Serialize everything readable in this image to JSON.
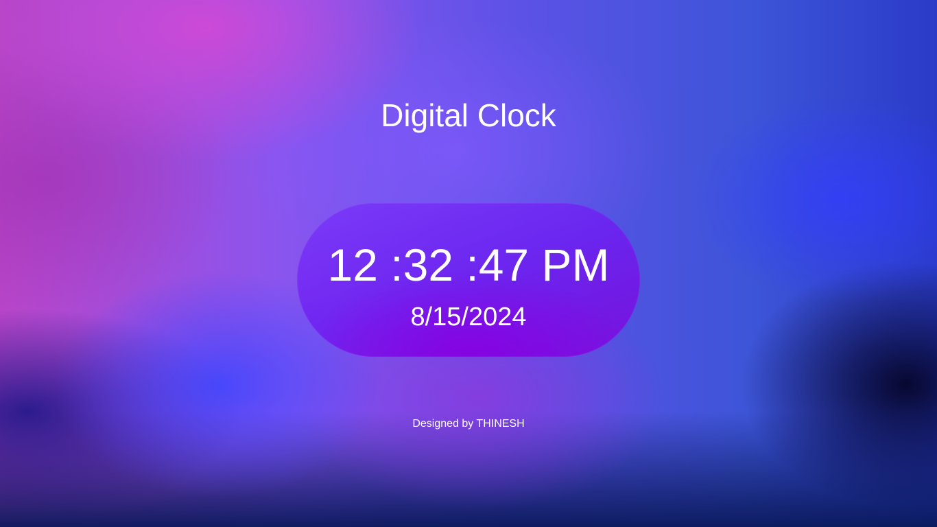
{
  "page": {
    "title": "Digital Clock"
  },
  "clock": {
    "time": "12 :32 :47 PM",
    "date": "8/15/2024"
  },
  "footer": {
    "credit": "Designed by THINESH"
  },
  "colors": {
    "text": "#ffffff",
    "pill": "#7a2cf0",
    "background_primary": "#6a50e8",
    "background_pink": "#d648d4",
    "background_blue": "#3c46ff"
  }
}
